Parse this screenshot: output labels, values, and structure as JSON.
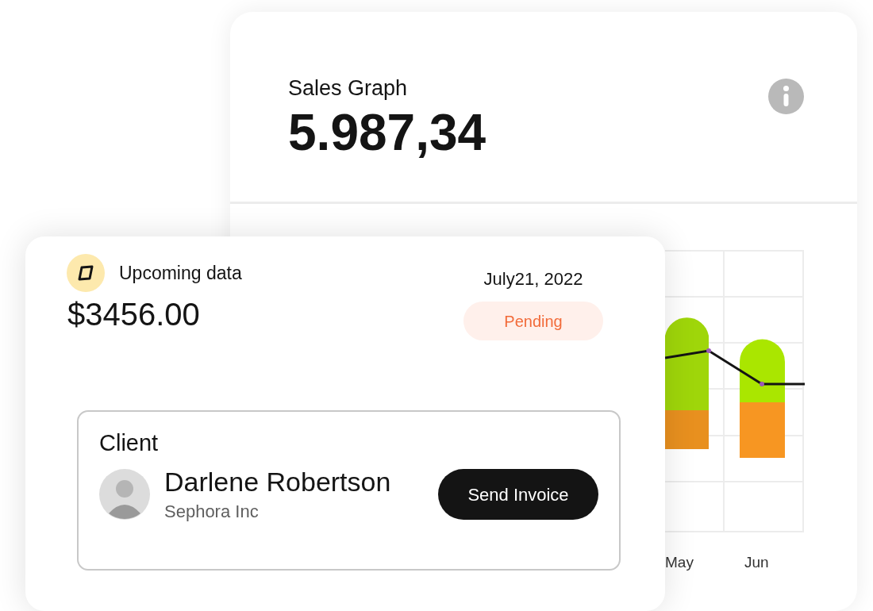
{
  "sales_graph": {
    "title": "Sales Graph",
    "value": "5.987,34",
    "chart": {
      "x_labels": [
        "May",
        "Jun"
      ]
    }
  },
  "upcoming": {
    "title": "Upcoming data",
    "amount": "$3456.00",
    "date": "July21, 2022",
    "status": {
      "label": "Pending",
      "kind": "pending"
    }
  },
  "client": {
    "heading": "Client",
    "name": "Darlene Robertson",
    "company": "Sephora Inc",
    "button": "Send Invoice"
  }
}
